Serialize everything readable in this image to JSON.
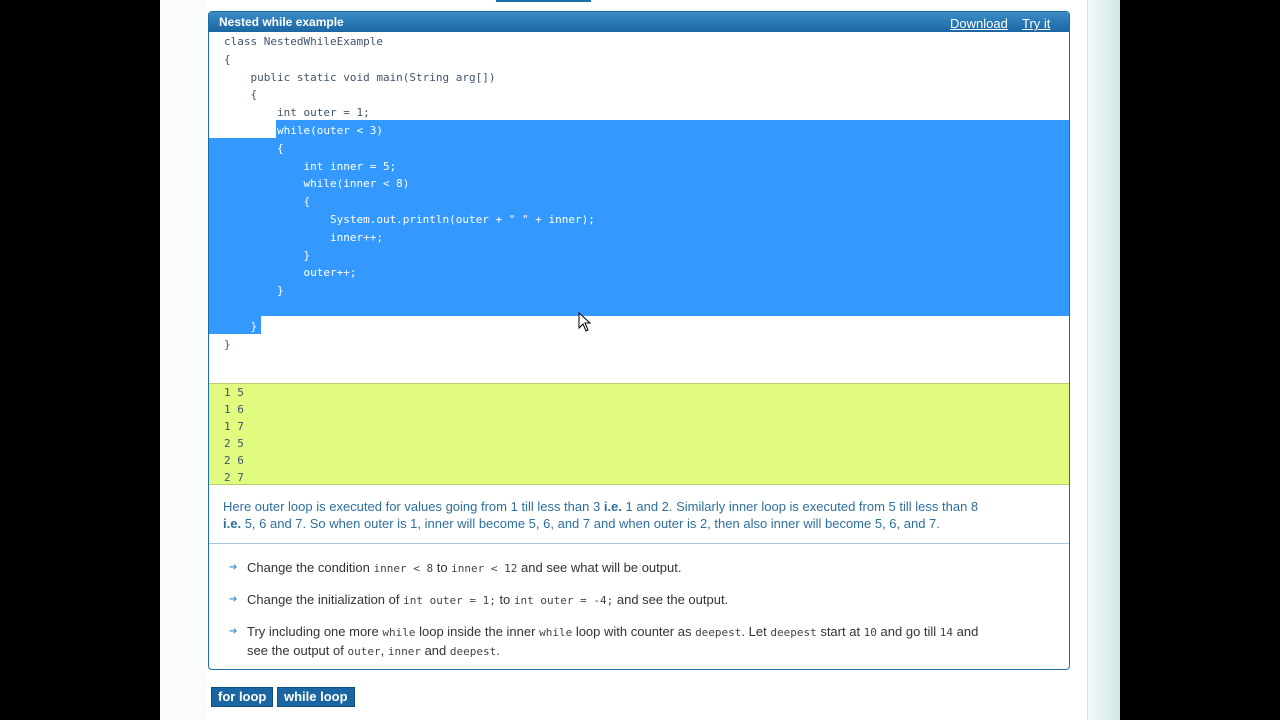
{
  "panel": {
    "title": "Nested while example",
    "download_label": "Download",
    "tryit_label": "Try it"
  },
  "code": {
    "lines": [
      "class NestedWhileExample",
      "{",
      "    public static void main(String arg[])",
      "    {",
      "        int outer = 1;",
      "        while(outer < 3)",
      "        {",
      "            int inner = 5;",
      "            while(inner < 8)",
      "            {",
      "                System.out.println(outer + \" \" + inner);",
      "                inner++;",
      "            }",
      "            outer++;",
      "        }",
      "",
      "    }",
      "}"
    ]
  },
  "output": {
    "lines": [
      "1 5",
      "1 6",
      "1 7",
      "2 5",
      "2 6",
      "2 7"
    ]
  },
  "explanation": {
    "part1": "Here outer loop is executed for values going from 1 till less than 3 ",
    "bold1": "i.e.",
    "part2": " 1 and 2. Similarly inner loop is executed from 5 till less than 8",
    "bold2": "i.e.",
    "part3": " 5, 6 and 7. So when outer is 1, inner will become 5, 6, and 7 and when outer is 2, then also inner will become 5, 6, and 7."
  },
  "exercises": {
    "item1": {
      "t1": "Change the condition ",
      "c1": "inner < 8",
      "t2": " to ",
      "c2": "inner < 12",
      "t3": " and see what will be output."
    },
    "item2": {
      "t1": "Change the initialization of ",
      "c1": "int outer = 1;",
      "t2": " to ",
      "c2": "int outer = -4;",
      "t3": " and see the output."
    },
    "item3": {
      "t1": "Try including one more ",
      "c1": "while",
      "t2": " loop inside the inner ",
      "c2": "while",
      "t3": " loop with counter as ",
      "c3": "deepest",
      "t4": ". Let ",
      "c4": "deepest",
      "t5": " start at ",
      "c5": "10",
      "t6": " and go till ",
      "c6": "14",
      "t7": " and",
      "t8": "see the output of ",
      "c7": "outer",
      "t9": ", ",
      "c8": "inner",
      "t10": " and ",
      "c9": "deepest",
      "t11": "."
    }
  },
  "tags": {
    "for_loop": "for loop",
    "while_loop": "while loop"
  },
  "colors": {
    "header_blue": "#1e73b0",
    "selection": "#3399ff",
    "output_bg": "#e0fb7d"
  }
}
